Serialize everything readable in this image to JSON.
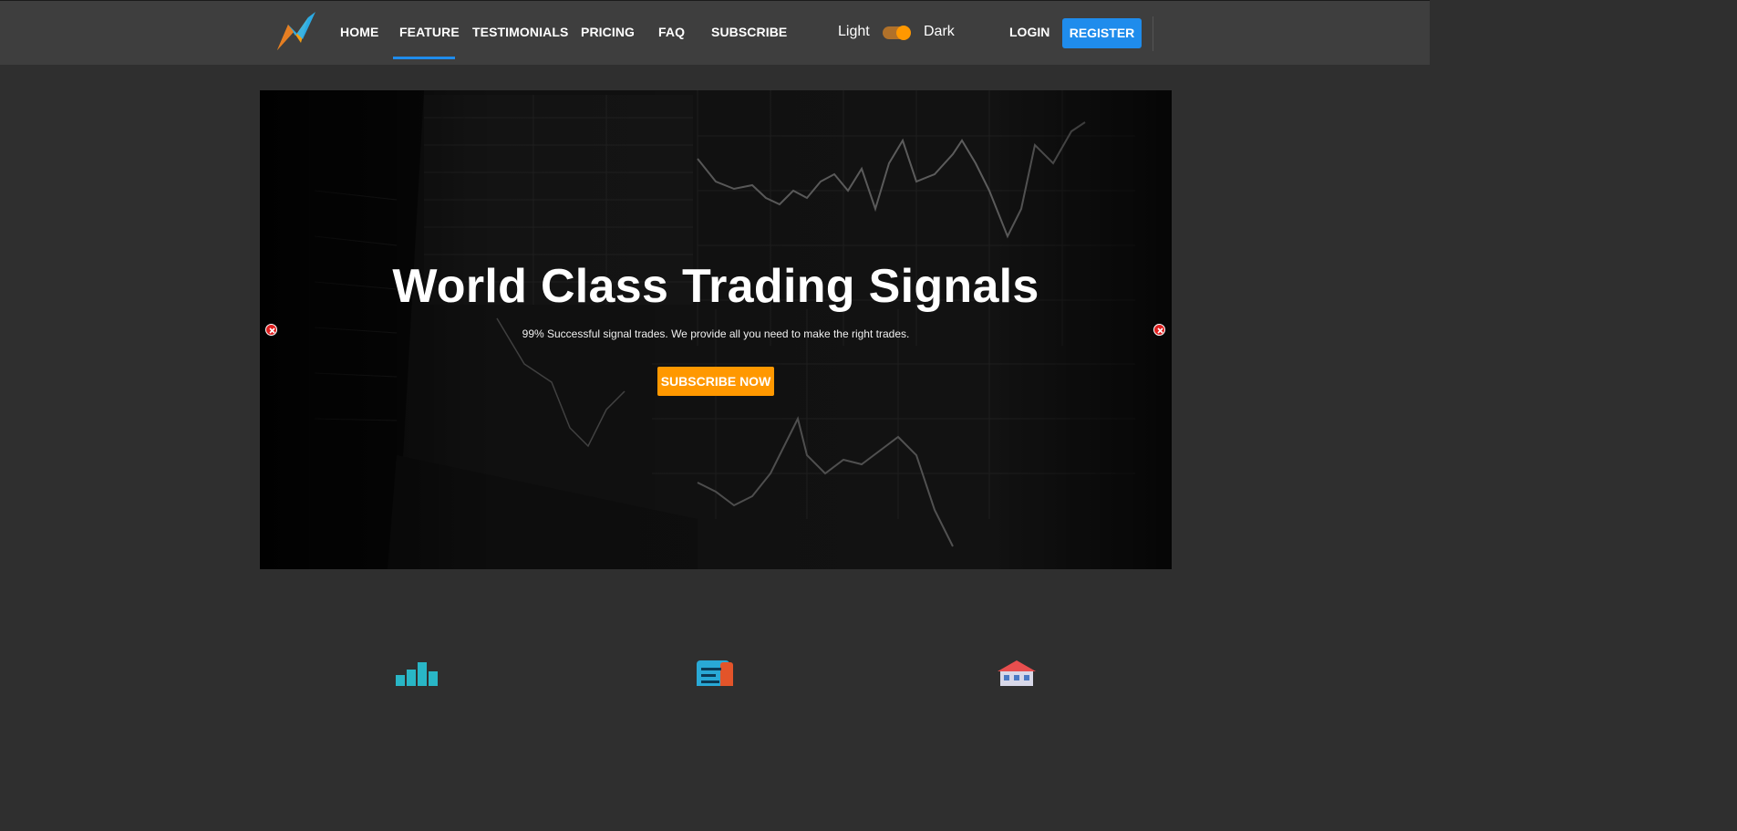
{
  "nav": {
    "logo_icon": "lightning-chart-logo",
    "items": [
      {
        "label": "HOME"
      },
      {
        "label": "FEATURE"
      },
      {
        "label": "TESTIMONIALS"
      },
      {
        "label": "PRICING"
      },
      {
        "label": "FAQ"
      },
      {
        "label": "SUBSCRIBE"
      }
    ],
    "active_item": "FEATURE",
    "theme_light_label": "Light",
    "theme_dark_label": "Dark",
    "theme_state": "dark",
    "login_label": "LOGIN",
    "register_label": "REGISTER"
  },
  "hero": {
    "title": "World Class Trading Signals",
    "subtitle": "99% Successful signal trades. We provide all you need to make the right trades.",
    "cta_label": "SUBSCRIBE NOW",
    "background": "trading-chart-monitor-photo"
  },
  "features": {
    "icons": [
      "bar-chart-icon",
      "document-icon",
      "building-icon"
    ]
  },
  "colors": {
    "accent_blue": "#1f8cec",
    "accent_orange": "#ff9800",
    "nav_bg": "#3e3e3e",
    "page_bg": "#2f2f2f"
  }
}
